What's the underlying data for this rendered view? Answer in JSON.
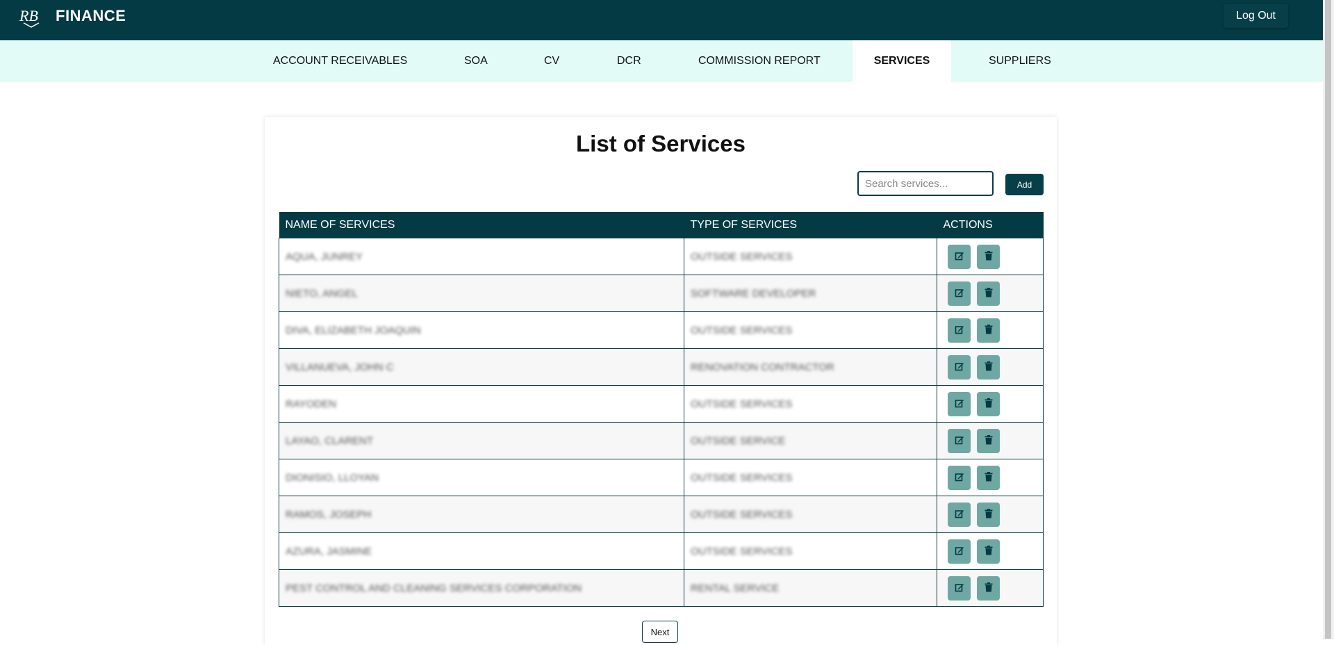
{
  "app": {
    "brand": "FINANCE",
    "logout_label": "Log Out"
  },
  "nav": [
    {
      "label": "ACCOUNT RECEIVABLES"
    },
    {
      "label": "SOA"
    },
    {
      "label": "CV"
    },
    {
      "label": "DCR"
    },
    {
      "label": "COMMISSION REPORT"
    },
    {
      "label": "SERVICES",
      "active": true
    },
    {
      "label": "SUPPLIERS"
    }
  ],
  "page": {
    "title": "List of Services",
    "search_placeholder": "Search services...",
    "add_label": "Add",
    "next_label": "Next"
  },
  "table": {
    "headers": [
      "NAME OF SERVICES",
      "TYPE OF SERVICES",
      "ACTIONS"
    ],
    "rows": [
      {
        "name": "AQUA, JUNREY",
        "type": "OUTSIDE SERVICES"
      },
      {
        "name": "NIETO, ANGEL",
        "type": "SOFTWARE DEVELOPER"
      },
      {
        "name": "DIVA, ELIZABETH JOAQUIN",
        "type": "OUTSIDE SERVICES"
      },
      {
        "name": "VILLANUEVA, JOHN C",
        "type": "RENOVATION CONTRACTOR"
      },
      {
        "name": "RAYODEN",
        "type": "OUTSIDE SERVICES"
      },
      {
        "name": "LAYAO, CLARENT",
        "type": "OUTSIDE SERVICE"
      },
      {
        "name": "DIONISIO, LLOYAN",
        "type": "OUTSIDE SERVICES"
      },
      {
        "name": "RAMOS, JOSEPH",
        "type": "OUTSIDE SERVICES"
      },
      {
        "name": "AZURA, JASMINE",
        "type": "OUTSIDE SERVICES"
      },
      {
        "name": "PEST CONTROL AND CLEANING SERVICES CORPORATION",
        "type": "RENTAL SERVICE"
      }
    ]
  },
  "colors": {
    "primary": "#043a43",
    "nav_bg": "#e3fbf6",
    "action_btn": "#6fa8a2"
  },
  "icons": {
    "edit": "edit-icon",
    "delete": "trash-icon"
  }
}
